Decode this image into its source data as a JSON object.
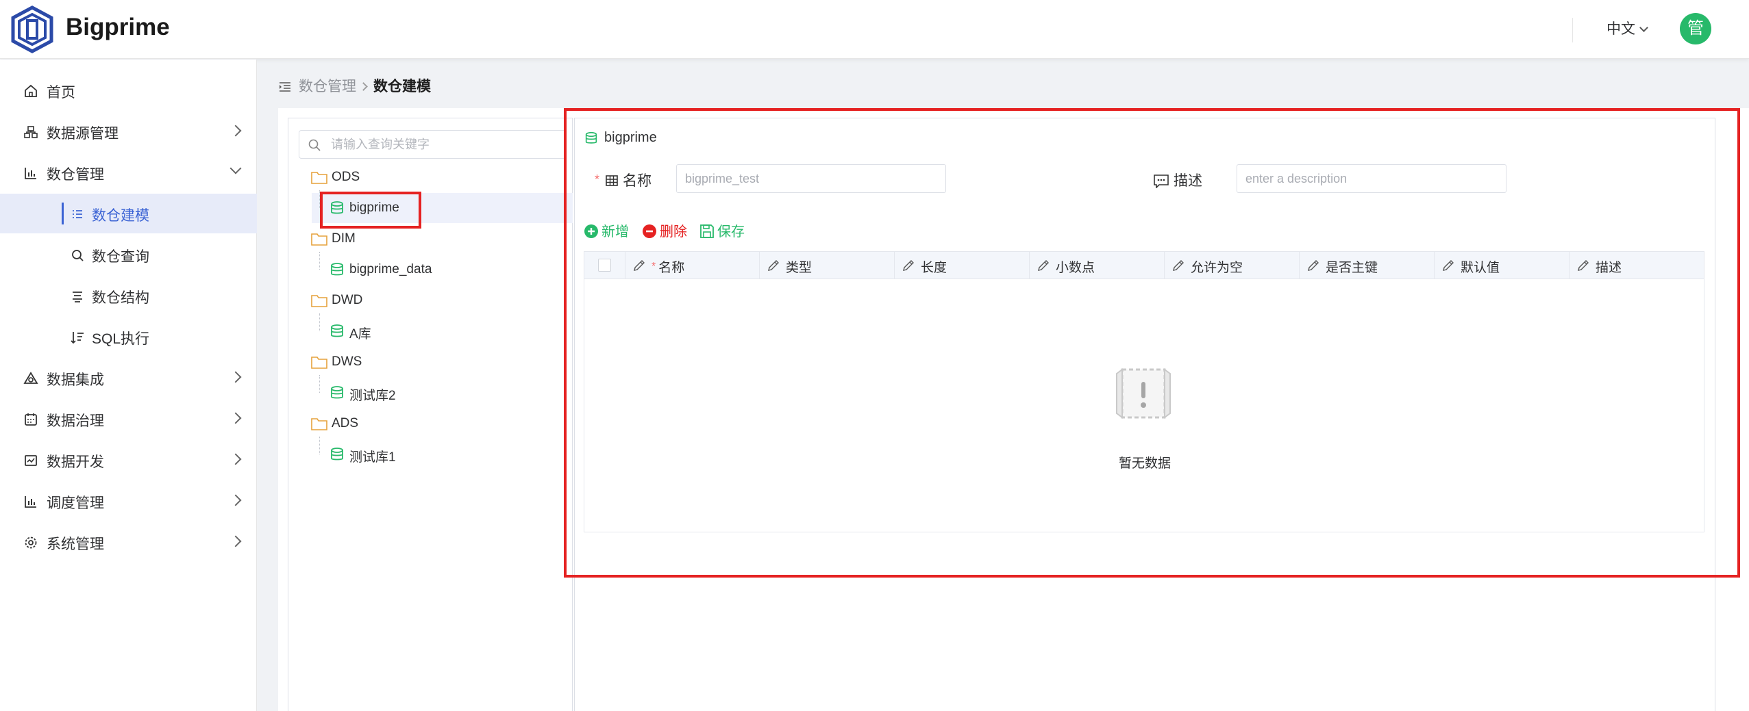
{
  "header": {
    "brand": "Bigprime",
    "language": "中文",
    "avatar_text": "管",
    "avatar_color": "#27b96a",
    "logo_color": "#2b4aa8"
  },
  "sidebar": {
    "items": [
      {
        "label": "首页",
        "icon": "home-icon"
      },
      {
        "label": "数据源管理",
        "icon": "datasource-icon"
      },
      {
        "label": "数仓管理",
        "icon": "bar-chart-icon"
      },
      {
        "label": "数仓建模",
        "icon": "list-icon"
      },
      {
        "label": "数仓查询",
        "icon": "search-icon"
      },
      {
        "label": "数仓结构",
        "icon": "structure-icon"
      },
      {
        "label": "SQL执行",
        "icon": "sql-sort-icon"
      },
      {
        "label": "数据集成",
        "icon": "integration-icon"
      },
      {
        "label": "数据治理",
        "icon": "calendar-icon"
      },
      {
        "label": "数据开发",
        "icon": "dev-icon"
      },
      {
        "label": "调度管理",
        "icon": "bar-chart-icon"
      },
      {
        "label": "系统管理",
        "icon": "settings-icon"
      }
    ],
    "active_color": "#3b63d4"
  },
  "breadcrumb": {
    "parent": "数仓管理",
    "current": "数仓建模"
  },
  "tree": {
    "search_placeholder": "请输入查询关键字",
    "groups": [
      {
        "name": "ODS",
        "children": [
          "bigprime"
        ]
      },
      {
        "name": "DIM",
        "children": [
          "bigprime_data"
        ]
      },
      {
        "name": "DWD",
        "children": [
          "A库"
        ]
      },
      {
        "name": "DWS",
        "children": [
          "测试库2"
        ]
      },
      {
        "name": "ADS",
        "children": [
          "测试库1"
        ]
      }
    ],
    "selected": "bigprime"
  },
  "form": {
    "db_name": "bigprime",
    "name_label": "名称",
    "name_placeholder": "bigprime_test",
    "desc_label": "描述",
    "desc_placeholder": "enter a description",
    "add_label": "新增",
    "delete_label": "删除",
    "save_label": "保存",
    "add_color": "#27b96a",
    "delete_color": "#e52222",
    "save_color": "#27b96a"
  },
  "table": {
    "columns": [
      "名称",
      "类型",
      "长度",
      "小数点",
      "允许为空",
      "是否主键",
      "默认值",
      "描述"
    ],
    "empty_text": "暂无数据"
  }
}
